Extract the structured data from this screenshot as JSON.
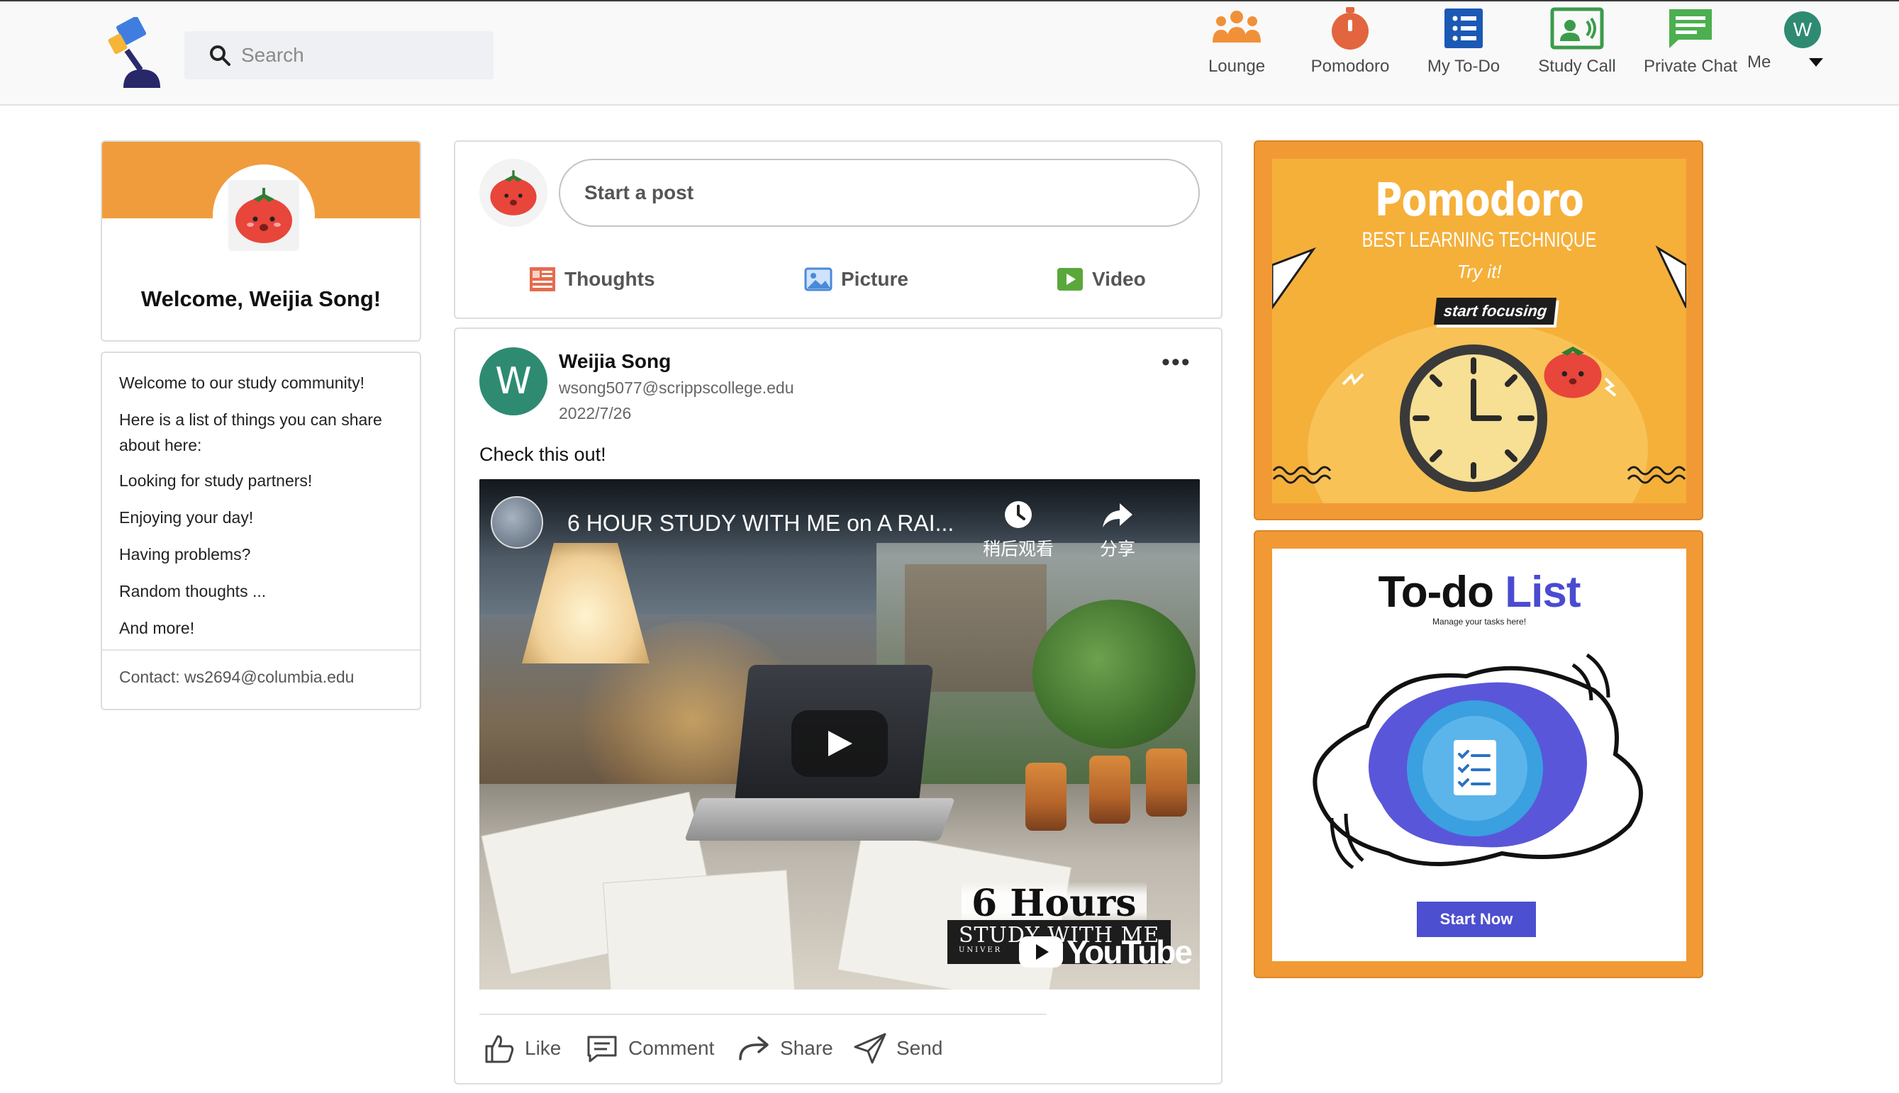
{
  "header": {
    "search_placeholder": "Search",
    "nav": [
      {
        "label": "Lounge",
        "icon": "people-icon"
      },
      {
        "label": "Pomodoro",
        "icon": "timer-icon"
      },
      {
        "label": "My To-Do",
        "icon": "checklist-icon"
      },
      {
        "label": "Study Call",
        "icon": "video-call-icon"
      },
      {
        "label": "Private Chat",
        "icon": "chat-icon"
      }
    ],
    "me": {
      "avatar_letter": "W",
      "label": "Me"
    }
  },
  "profile": {
    "welcome": "Welcome, Weijia Song!"
  },
  "info": {
    "lines": [
      "Welcome to our study community!",
      "Here is a list of things you can share about here:",
      "Looking for study partners!",
      "Enjoying your day!",
      "Having problems?",
      "Random thoughts ...",
      "And more!"
    ],
    "contact": "Contact: ws2694@columbia.edu"
  },
  "composer": {
    "placeholder": "Start a post",
    "actions": [
      {
        "label": "Thoughts",
        "icon": "article-icon",
        "color": "#e46c4e"
      },
      {
        "label": "Picture",
        "icon": "image-icon",
        "color": "#4a8ad8"
      },
      {
        "label": "Video",
        "icon": "video-play-icon",
        "color": "#5aa83c"
      }
    ]
  },
  "post": {
    "avatar_letter": "W",
    "author": "Weijia Song",
    "email": "wsong5077@scrippscollege.edu",
    "date": "2022/7/26",
    "text": "Check this out!",
    "video": {
      "title": "6 HOUR STUDY WITH ME on A RAI...",
      "watch_later": "稍后观看",
      "share": "分享",
      "overlay_hours": "6 Hours",
      "overlay_sub": "STUDY WITH ME",
      "overlay_small": "UNIVER",
      "brand": "YouTube"
    },
    "actions": [
      {
        "label": "Like",
        "icon": "thumbs-up-icon"
      },
      {
        "label": "Comment",
        "icon": "comment-icon"
      },
      {
        "label": "Share",
        "icon": "share-arrow-icon"
      },
      {
        "label": "Send",
        "icon": "send-icon"
      }
    ]
  },
  "ads": {
    "pomodoro": {
      "title": "Pomodoro",
      "subtitle": "BEST LEARNING TECHNIQUE",
      "tagline": "Try it!",
      "badge": "start focusing"
    },
    "todo": {
      "title_a": "To-do",
      "title_b": "List",
      "subtitle": "Manage your tasks here!",
      "button": "Start Now"
    }
  },
  "colors": {
    "brand_orange": "#f09c3c",
    "avatar_green": "#2e8b72",
    "todo_blue": "#4c4fcf"
  }
}
